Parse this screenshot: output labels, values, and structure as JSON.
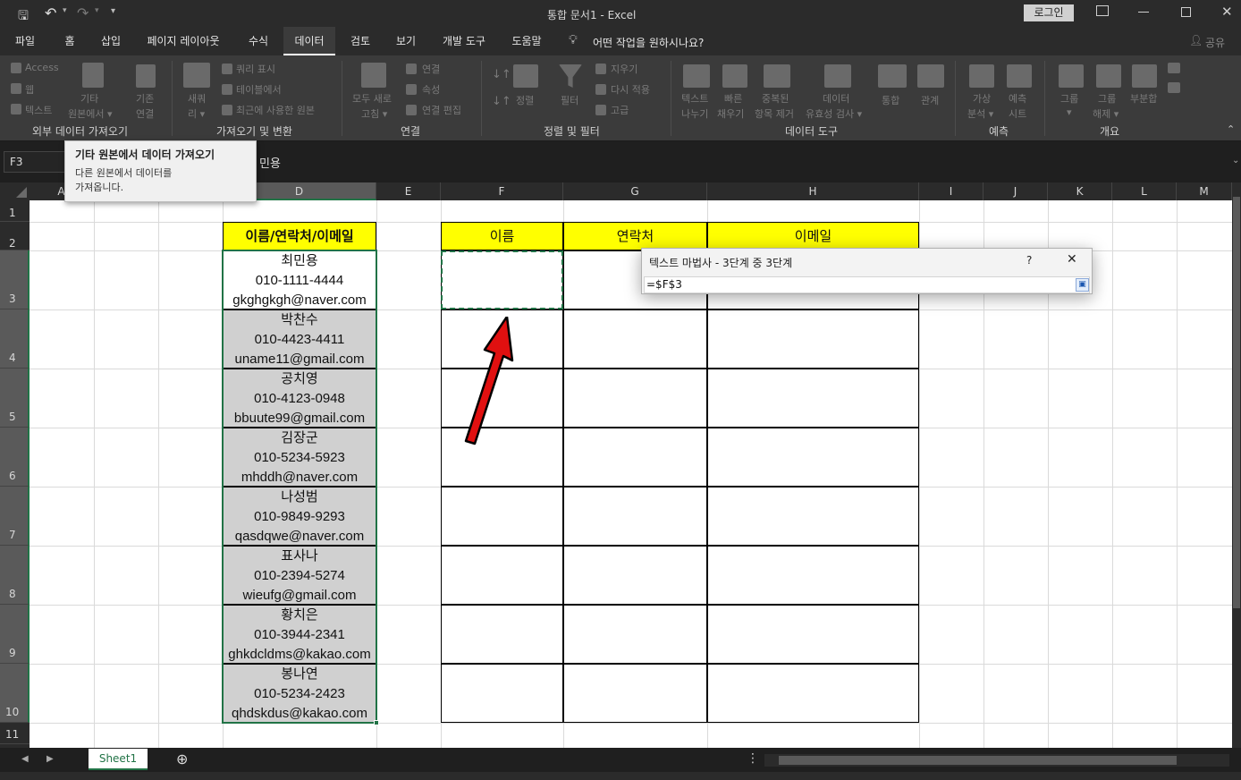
{
  "window": {
    "title": "통합 문서1  -  Excel",
    "login_label": "로그인",
    "share_label": "공유",
    "qat_dropdown": "▾"
  },
  "tabs": [
    "파일",
    "홈",
    "삽입",
    "페이지 레이아웃",
    "수식",
    "데이터",
    "검토",
    "보기",
    "개발 도구",
    "도움말"
  ],
  "active_tab": "데이터",
  "tellme": "어떤 작업을 원하시나요?",
  "ribbon": {
    "groups": {
      "external": "외부 데이터 가져오기",
      "transform": "가져오기 및 변환",
      "connections": "연결",
      "sort_filter": "정렬 및 필터",
      "data_tools": "데이터 도구",
      "forecast": "예측",
      "outline": "개요"
    },
    "items": {
      "access": "Access",
      "web": "웹",
      "text": "텍스트",
      "other_sources_1": "기타",
      "other_sources_2": "원본에서 ▾",
      "existing_1": "기존",
      "existing_2": "연결",
      "new_query_1": "새쿼",
      "new_query_2": "리 ▾",
      "show_queries": "쿼리 표시",
      "from_table": "테이블에서",
      "recent_sources": "최근에 사용한 원본",
      "refresh_all_1": "모두 새로",
      "refresh_all_2": "고침 ▾",
      "connections": "연결",
      "properties": "속성",
      "edit_links": "연결 편집",
      "sort": "정렬",
      "filter": "필터",
      "clear": "지우기",
      "reapply": "다시 적용",
      "advanced": "고급",
      "text_to_columns_1": "텍스트",
      "text_to_columns_2": "나누기",
      "flash_fill_1": "빠른",
      "flash_fill_2": "채우기",
      "remove_dup_1": "중복된",
      "remove_dup_2": "항목 제거",
      "validation_1": "데이터",
      "validation_2": "유효성 검사 ▾",
      "consolidate": "통합",
      "relationships": "관계",
      "whatif_1": "가상",
      "whatif_2": "분석 ▾",
      "forecast_1": "예측",
      "forecast_2": "시트",
      "group_1": "그룹",
      "ungroup_1": "그룹",
      "ungroup_2": "해제 ▾",
      "subtotal": "부분합"
    }
  },
  "tooltip": {
    "title": "기타 원본에서 데이터 가져오기",
    "line1": "다른 원본에서 데이터를",
    "line2": "가져옵니다."
  },
  "formula_bar": {
    "name_box": "F3",
    "content": "민용"
  },
  "columns": [
    "A",
    "B",
    "C",
    "D",
    "E",
    "F",
    "G",
    "H",
    "I",
    "J",
    "K",
    "L",
    "M"
  ],
  "rows": [
    "1",
    "2",
    "3",
    "4",
    "5",
    "6",
    "7",
    "8",
    "9",
    "10",
    "11"
  ],
  "sheet": {
    "d_header": "이름/연락처/이메일",
    "headers": [
      "이름",
      "연락처",
      "이메일"
    ],
    "records": [
      {
        "name": "최민용",
        "phone": "010-1111-4444",
        "email": "gkghgkgh@naver.com"
      },
      {
        "name": "박찬수",
        "phone": "010-4423-4411",
        "email": "uname11@gmail.com"
      },
      {
        "name": "공치영",
        "phone": "010-4123-0948",
        "email": "bbuute99@gmail.com"
      },
      {
        "name": "김장군",
        "phone": "010-5234-5923",
        "email": "mhddh@naver.com"
      },
      {
        "name": "나성범",
        "phone": "010-9849-9293",
        "email": "qasdqwe@naver.com"
      },
      {
        "name": "표사나",
        "phone": "010-2394-5274",
        "email": "wieufg@gmail.com"
      },
      {
        "name": "황치은",
        "phone": "010-3944-2341",
        "email": "ghkdcldms@kakao.com"
      },
      {
        "name": "봉나연",
        "phone": "010-5234-2423",
        "email": "qhdskdus@kakao.com"
      }
    ]
  },
  "dialog": {
    "title": "텍스트 마법사 - 3단계 중 3단계",
    "help": "?",
    "close": "✕",
    "ref_value": "=$F$3"
  },
  "sheet_tabs": {
    "active": "Sheet1",
    "add": "⊕"
  },
  "colors": {
    "header_yellow": "#ffff00",
    "data_gray": "#d0d0d0",
    "selection_green": "#217346",
    "arrow_red": "#e01010"
  }
}
